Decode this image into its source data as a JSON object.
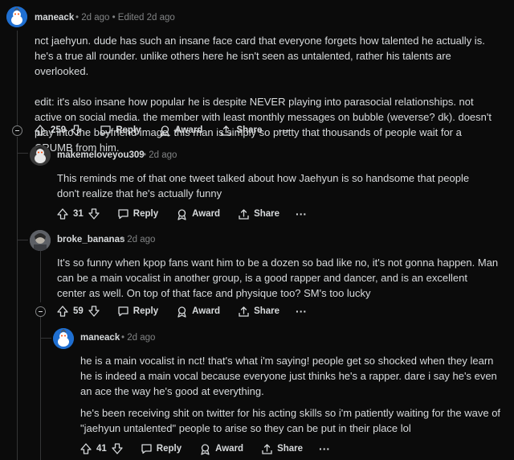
{
  "comments": [
    {
      "username": "maneack",
      "meta": "• 2d ago • Edited 2d ago",
      "paragraphs": [
        "nct jaehyun. dude has such an insane face card that everyone forgets how talented he actually is. he's a true all rounder. unlike others here he isn't seen as untalented, rather his talents are overlooked.",
        "edit: it's also insane how popular he is despite NEVER playing into parasocial relationships. not active on social media. the member with least monthly messages on bubble (weverse? dk). doesn't play into the boyfriend image. this man is simply so pretty that thousands of people wait for a CRUMB from him."
      ],
      "votes": "259"
    },
    {
      "username": "makemeloveyou309",
      "meta": "• 2d ago",
      "paragraphs": [
        "This reminds me of that one tweet talked about how Jaehyun is so handsome that people don't realize that he's actually funny"
      ],
      "votes": "31"
    },
    {
      "username": "broke_bananas",
      "meta": "• 2d ago",
      "paragraphs": [
        "It's so funny when kpop fans want him to be a dozen so bad like no, it's not gonna happen. Man can be a main vocalist in another group, is a good rapper and dancer, and is an excellent center as well. On top of that face and physique too? SM's too lucky"
      ],
      "votes": "59"
    },
    {
      "username": "maneack",
      "meta": "• 2d ago",
      "paragraphs": [
        "he is a main vocalist in nct! that's what i'm saying! people get so shocked when they learn he is indeed a main vocal because everyone just thinks he's a rapper. dare i say he's even an ace the way he's good at everything.",
        "he's been receiving shit on twitter for his acting skills so i'm patiently waiting for the wave of \"jaehyun untalented\" people to arise so they can be put in their place lol"
      ],
      "votes": "41"
    }
  ],
  "actions": {
    "reply": "Reply",
    "award": "Award",
    "share": "Share",
    "more": "···"
  },
  "colors": {
    "background": "#0b0b0b",
    "text": "#d7dadc",
    "muted": "#818384",
    "thread_line": "#343536",
    "avatar_blue": "#1f6fd1"
  }
}
